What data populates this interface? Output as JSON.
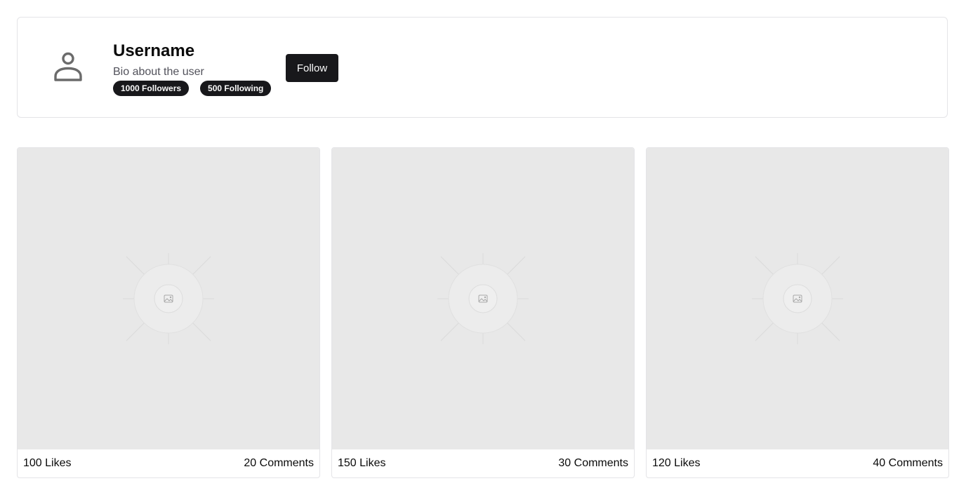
{
  "profile": {
    "username": "Username",
    "bio": "Bio about the user",
    "followers_label": "1000 Followers",
    "following_label": "500 Following",
    "follow_button": "Follow",
    "avatar_icon": "user-icon"
  },
  "posts": [
    {
      "image_icon": "image-placeholder-icon",
      "likes": "100 Likes",
      "comments": "20 Comments"
    },
    {
      "image_icon": "image-placeholder-icon",
      "likes": "150 Likes",
      "comments": "30 Comments"
    },
    {
      "image_icon": "image-placeholder-icon",
      "likes": "120 Likes",
      "comments": "40 Comments"
    }
  ],
  "colors": {
    "primary": "#18181b",
    "border": "#e4e4e7",
    "placeholder_bg": "#e8e8e8",
    "muted_text": "#52525b"
  }
}
